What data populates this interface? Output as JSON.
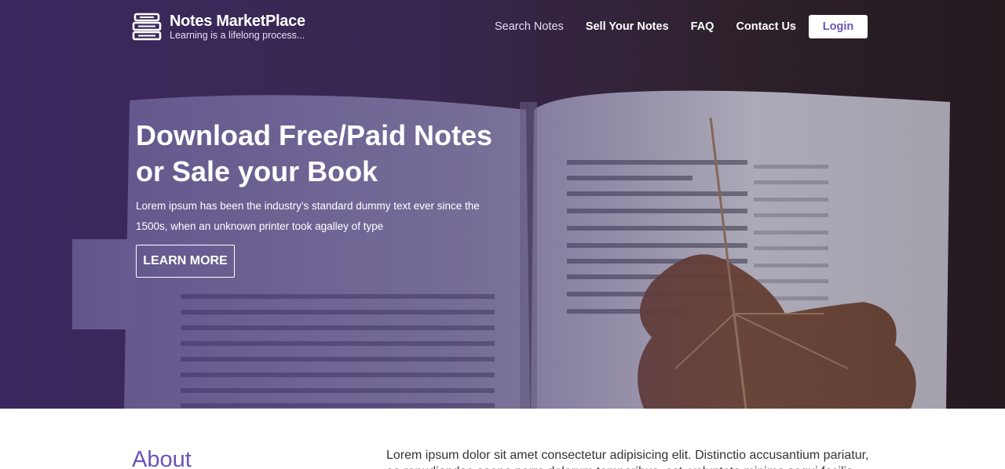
{
  "brand": {
    "title": "Notes MarketPlace",
    "tagline": "Learning is a lifelong process..."
  },
  "nav": {
    "items": [
      {
        "label": "Search Notes",
        "active": true
      },
      {
        "label": "Sell Your Notes",
        "active": false
      },
      {
        "label": "FAQ",
        "active": false
      },
      {
        "label": "Contact Us",
        "active": false
      }
    ],
    "login_label": "Login"
  },
  "hero": {
    "title_line1": "Download Free/Paid Notes",
    "title_line2": "or Sale your Book",
    "description": "Lorem ipsum has been the industry's standard dummy text ever since the 1500s, when an unknown printer took agalley of type",
    "button_label": "LEARN MORE"
  },
  "about": {
    "heading": "About",
    "text": "Lorem ipsum dolor sit amet consectetur adipisicing elit. Distinctio accusantium pariatur, ea repudiandae saepe porro dolorum temporibus, est, voluptate minima sequi facilis"
  },
  "colors": {
    "accent": "#6a54b8",
    "overlay": "#3a2870",
    "text": "#333333"
  },
  "icons": {
    "logo": "book-stack-icon"
  }
}
